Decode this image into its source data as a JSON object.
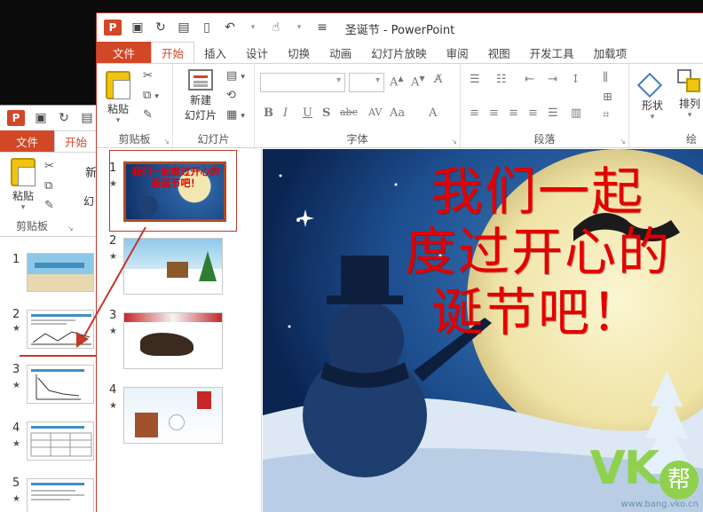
{
  "front_window": {
    "title": "圣诞节 - PowerPoint",
    "app_logo": "P",
    "tabs": [
      "文件",
      "开始",
      "插入",
      "设计",
      "切换",
      "动画",
      "幻灯片放映",
      "审阅",
      "视图",
      "开发工具",
      "加载项"
    ],
    "active_tab": "开始",
    "groups": {
      "clipboard": {
        "label": "剪贴板",
        "paste": "粘贴"
      },
      "slides": {
        "label": "幻灯片",
        "new_slide_line1": "新建",
        "new_slide_line2": "幻灯片"
      },
      "font": {
        "label": "字体"
      },
      "paragraph": {
        "label": "段落"
      },
      "drawing": {
        "label": "绘",
        "shape": "形状",
        "arrange": "排列"
      }
    },
    "slides": [
      {
        "num": "1",
        "star": "★",
        "mini_title": "我们一起度过开心的圣诞节吧！"
      },
      {
        "num": "2",
        "star": "★"
      },
      {
        "num": "3",
        "star": "★"
      },
      {
        "num": "4",
        "star": "★"
      }
    ],
    "slide_title_lines": [
      "我们一起",
      "度过开心的",
      "诞节吧！"
    ]
  },
  "back_window": {
    "app_logo": "P",
    "tabs": [
      "文件",
      "开始"
    ],
    "active_tab": "开始",
    "paste": "粘贴",
    "group_label": "剪贴板",
    "partial_new": "新",
    "partial_slide": "幻",
    "slides": [
      {
        "num": "1",
        "star": ""
      },
      {
        "num": "2",
        "star": "★"
      },
      {
        "num": "3",
        "star": "★"
      },
      {
        "num": "4",
        "star": "★"
      },
      {
        "num": "5",
        "star": "★"
      }
    ]
  },
  "watermark": {
    "logo": "VK",
    "badge": "帮",
    "url": "www.bang.vko.cn"
  },
  "colors": {
    "accent": "#d24726",
    "title_red": "#e30000",
    "drag_arrow": "#c0392b"
  }
}
